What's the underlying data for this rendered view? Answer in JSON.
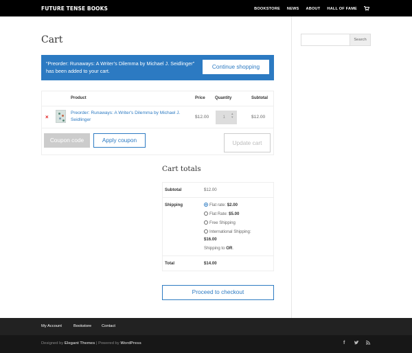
{
  "header": {
    "logo": "FUTURE TENSE BOOKS",
    "nav": [
      "BOOKSTORE",
      "NEWS",
      "ABOUT",
      "HALL OF FAME"
    ],
    "cart_icon": "shopping-cart-icon"
  },
  "sidebar": {
    "search_placeholder": "",
    "search_button": "Search"
  },
  "main": {
    "title": "Cart",
    "notice": {
      "message": "“Preorder: Runaways: A Writer’s Dilemma by Michael J. Seidlinger” has been added to your cart.",
      "button": "Continue shopping"
    },
    "table": {
      "headers": [
        "Product",
        "Price",
        "Quantity",
        "Subtotal"
      ],
      "rows": [
        {
          "remove": "×",
          "product": "Preorder: Runaways: A Writer's Dilemma by Michael J. Seidlinger",
          "price": "$12.00",
          "quantity": "1",
          "subtotal": "$12.00"
        }
      ]
    },
    "coupon_placeholder": "Coupon code",
    "apply_coupon": "Apply coupon",
    "update_cart": "Update cart"
  },
  "totals": {
    "title": "Cart totals",
    "subtotal_label": "Subtotal",
    "subtotal_value": "$12.00",
    "shipping_label": "Shipping",
    "shipping_options": [
      {
        "label": "Flat rate:",
        "price": "$2.00",
        "selected": true
      },
      {
        "label": "Flat Rate:",
        "price": "$5.00",
        "selected": false
      },
      {
        "label": "Free Shipping",
        "price": "",
        "selected": false
      },
      {
        "label": "International Shipping:",
        "price": "$16.00",
        "selected": false
      }
    ],
    "shipping_to_prefix": "Shipping to",
    "shipping_to_state": "OR",
    "total_label": "Total",
    "total_value": "$14.00",
    "checkout_button": "Proceed to checkout"
  },
  "footer": {
    "links": [
      "My Account",
      "Bookstore",
      "Contact"
    ],
    "credits_prefix": "Designed by",
    "credits_theme": "Elegant Themes",
    "credits_mid": "| Powered by",
    "credits_wp": "WordPress",
    "social_icons": [
      "facebook-icon",
      "twitter-icon",
      "rss-icon"
    ]
  },
  "colors": {
    "accent": "#2c7ac2",
    "remove": "#e21a1a",
    "topbar": "#000000",
    "footer": "#222222"
  }
}
